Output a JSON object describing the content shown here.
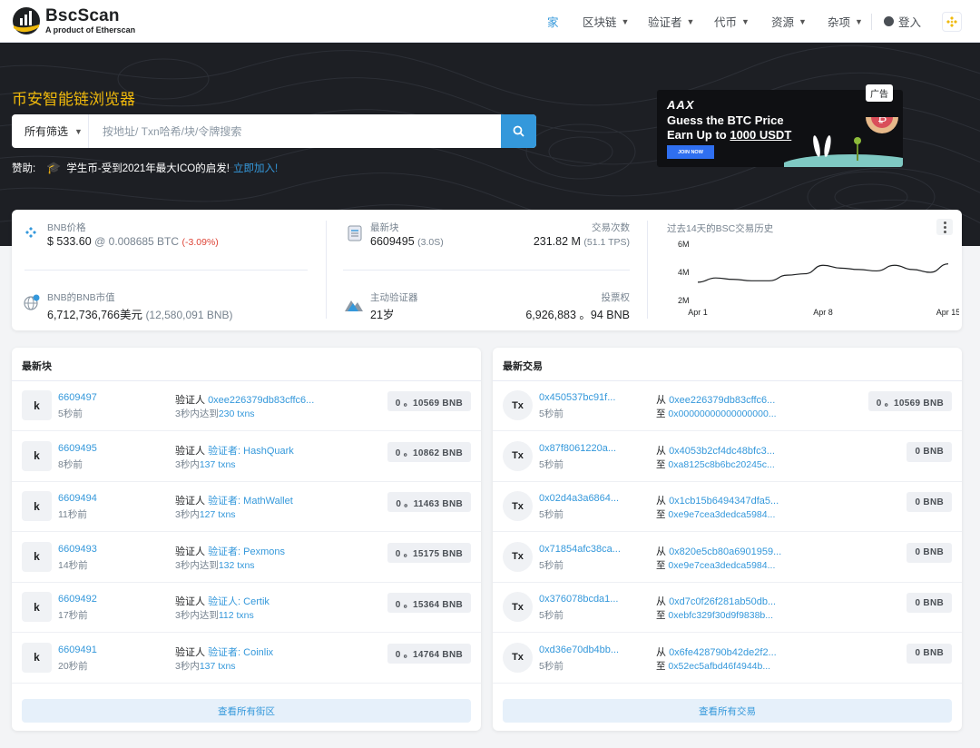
{
  "header": {
    "brand": "BscScan",
    "brand_sub": "A product of Etherscan",
    "nav": {
      "home": "家",
      "blockchain": "区块链",
      "validators": "验证者",
      "tokens": "代币",
      "resources": "资源",
      "misc": "杂项",
      "login": "登入"
    }
  },
  "hero": {
    "title": "币安智能链浏览器",
    "filter_label": "所有筛选",
    "search_placeholder": "按地址/ Txn哈希/块/令牌搜索",
    "sponsor_label": "赞助:",
    "sponsor_text": "学生币-受到2021年最大ICO的启发!",
    "sponsor_link": "立即加入!"
  },
  "ad": {
    "badge": "广告",
    "logo": "AAX",
    "line1": "Guess the BTC Price",
    "line2_prefix": "Earn Up to ",
    "line2_amount": "1000 USDT",
    "button": "JOIN NOW"
  },
  "stats": {
    "price_label": "BNB价格",
    "price_value": "$ 533.60",
    "price_btc": "@ 0.008685 BTC",
    "price_change": "(-3.09%)",
    "mcap_label": "BNB的BNB市值",
    "mcap_value": "6,712,736,766美元",
    "mcap_bnb": "(12,580,091 BNB)",
    "block_label": "最新块",
    "block_value": "6609495",
    "block_time": "(3.0S)",
    "tx_label": "交易次数",
    "tx_value": "231.82 M",
    "tx_tps": "(51.1 TPS)",
    "validator_label": "主动验证器",
    "validator_value": "21岁",
    "vote_label": "投票权",
    "vote_value": "6,926,883 。94 BNB"
  },
  "chart_data": {
    "type": "line",
    "title": "过去14天的BSC交易历史",
    "x": [
      "Apr 1",
      "Apr 2",
      "Apr 3",
      "Apr 4",
      "Apr 5",
      "Apr 6",
      "Apr 7",
      "Apr 8",
      "Apr 9",
      "Apr 10",
      "Apr 11",
      "Apr 12",
      "Apr 13",
      "Apr 14",
      "Apr 15"
    ],
    "series": [
      {
        "values": [
          3.3,
          3.6,
          3.5,
          3.4,
          3.4,
          3.8,
          3.9,
          4.5,
          4.3,
          4.2,
          4.1,
          4.5,
          4.2,
          4.0,
          4.6
        ]
      }
    ],
    "x_ticks": [
      "Apr 1",
      "Apr 8",
      "Apr 15"
    ],
    "y_ticks": [
      "6M",
      "4M",
      "2M"
    ],
    "ylim": [
      2,
      6
    ],
    "grid": false
  },
  "blocks_panel": {
    "title": "最新块",
    "validator_prefix": "验证人",
    "view_all": "查看所有街区",
    "avatar": "k",
    "rows": [
      {
        "number": "6609497",
        "age": "5秒前",
        "validator": "0xee226379db83cffc6...",
        "time_prefix": "3秒内达到",
        "txns": "230 txns",
        "amount": "0 。10569 BNB"
      },
      {
        "number": "6609495",
        "age": "8秒前",
        "validator": "验证者: HashQuark",
        "time_prefix": "3秒内",
        "txns": "137 txns",
        "amount": "0 。10862 BNB"
      },
      {
        "number": "6609494",
        "age": "11秒前",
        "validator": "验证者: MathWallet",
        "time_prefix": "3秒内",
        "txns": "127 txns",
        "amount": "0 。11463 BNB"
      },
      {
        "number": "6609493",
        "age": "14秒前",
        "validator": "验证者: Pexmons",
        "time_prefix": "3秒内达到",
        "txns": "132 txns",
        "amount": "0 。15175 BNB"
      },
      {
        "number": "6609492",
        "age": "17秒前",
        "validator": "验证人: Certik",
        "time_prefix": "3秒内达到",
        "txns": "112 txns",
        "amount": "0 。15364 BNB"
      },
      {
        "number": "6609491",
        "age": "20秒前",
        "validator": "验证者: Coinlix",
        "time_prefix": "3秒内",
        "txns": "137 txns",
        "amount": "0 。14764 BNB"
      }
    ]
  },
  "tx_panel": {
    "title": "最新交易",
    "from_prefix": "从",
    "to_prefix": "至",
    "view_all": "查看所有交易",
    "avatar": "Tx",
    "rows": [
      {
        "hash": "0x450537bc91f...",
        "age": "5秒前",
        "from": "0xee226379db83cffc6...",
        "to": "0x00000000000000000...",
        "amount": "0 。10569 BNB"
      },
      {
        "hash": "0x87f8061220a...",
        "age": "5秒前",
        "from": "0x4053b2cf4dc48bfc3...",
        "to": "0xa8125c8b6bc20245c...",
        "amount": "0 BNB"
      },
      {
        "hash": "0x02d4a3a6864...",
        "age": "5秒前",
        "from": "0x1cb15b6494347dfa5...",
        "to": "0xe9e7cea3dedca5984...",
        "amount": "0 BNB"
      },
      {
        "hash": "0x71854afc38ca...",
        "age": "5秒前",
        "from": "0x820e5cb80a6901959...",
        "to": "0xe9e7cea3dedca5984...",
        "amount": "0 BNB"
      },
      {
        "hash": "0x376078bcda1...",
        "age": "5秒前",
        "from": "0xd7c0f26f281ab50db...",
        "to": "0xebfc329f30d9f9838b...",
        "amount": "0 BNB"
      },
      {
        "hash": "0xd36e70db4bb...",
        "age": "5秒前",
        "from": "0x6fe428790b42de2f2...",
        "to": "0x52ec5afbd46f4944b...",
        "amount": "0 BNB"
      }
    ]
  }
}
